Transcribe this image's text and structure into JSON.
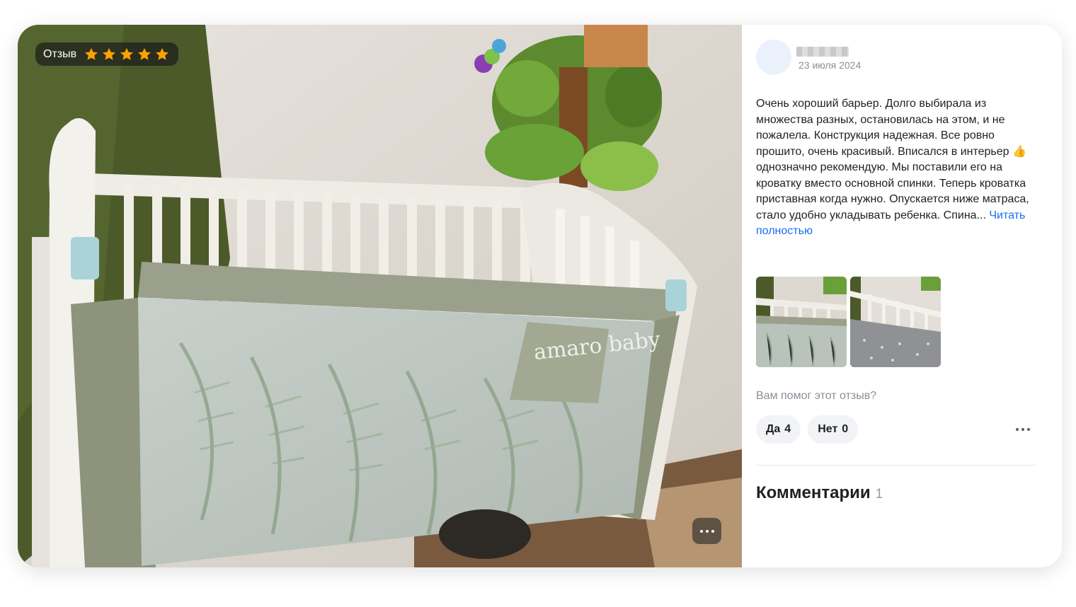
{
  "photo": {
    "badge_label": "Отзыв",
    "rating": 5,
    "rating_max": 5,
    "star_color": "#ffa200",
    "brand_print": "amaro baby"
  },
  "review": {
    "date": "23 июля 2024",
    "text": "Очень хороший барьер. Долго выбирала из множества разных, остановилась на этом, и не пожалела. Конструкция надежная. Все ровно прошито, очень красивый. Вписался в интерьер 👍 однозначно рекомендую. Мы поставили его на кроватку вместо основной спинки. Теперь кроватка приставная когда нужно. Опускается ниже матраса, стало удобно укладывать ребенка. Спина...",
    "read_more": "Читать полностью",
    "link_color": "#1a6df0"
  },
  "helpful": {
    "question": "Вам помог этот отзыв?",
    "yes_label": "Да",
    "yes_count": "4",
    "no_label": "Нет",
    "no_count": "0"
  },
  "comments": {
    "title": "Комментарии",
    "count": "1"
  }
}
